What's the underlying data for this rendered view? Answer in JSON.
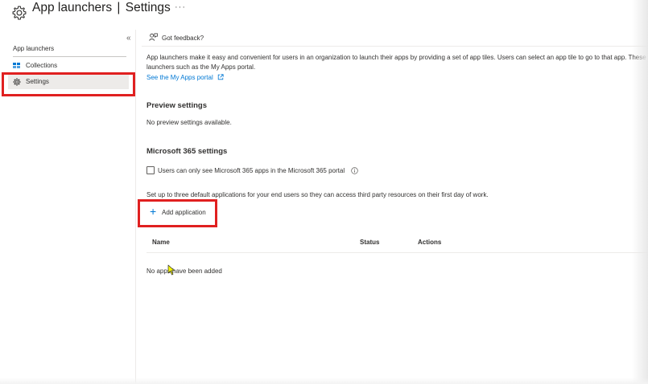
{
  "header": {
    "title": "App launchers",
    "separator": "|",
    "subtitle": "Settings",
    "more_label": "···",
    "icon": "gear-icon"
  },
  "sidebar": {
    "collapse_label": "«",
    "heading": "App launchers",
    "items": [
      {
        "label": "Collections",
        "icon": "collections-icon",
        "selected": false
      },
      {
        "label": "Settings",
        "icon": "gear-icon",
        "selected": true
      }
    ]
  },
  "command_bar": {
    "feedback_label": "Got feedback?",
    "feedback_icon": "feedback-icon"
  },
  "main": {
    "description": "App launchers make it easy and convenient for users in an organization to launch their apps by providing a set of app tiles. Users can select an app tile to go to that app. These launchers such as the My Apps portal.",
    "portal_link": "See the My Apps portal",
    "preview_heading": "Preview settings",
    "preview_text": "No preview settings available.",
    "m365_heading": "Microsoft 365 settings",
    "m365_checkbox_label": "Users can only see Microsoft 365 apps in the Microsoft 365 portal",
    "m365_checkbox_checked": false,
    "setup_text": "Set up to three default applications for your end users so they can access third party resources on their first day of work.",
    "add_button_label": "Add application",
    "table": {
      "columns": [
        "Name",
        "Status",
        "Actions"
      ],
      "empty_text": "No apps have been added"
    }
  },
  "colors": {
    "accent": "#0078d4",
    "highlight": "#e02020",
    "selected_bg": "#edebe9"
  }
}
